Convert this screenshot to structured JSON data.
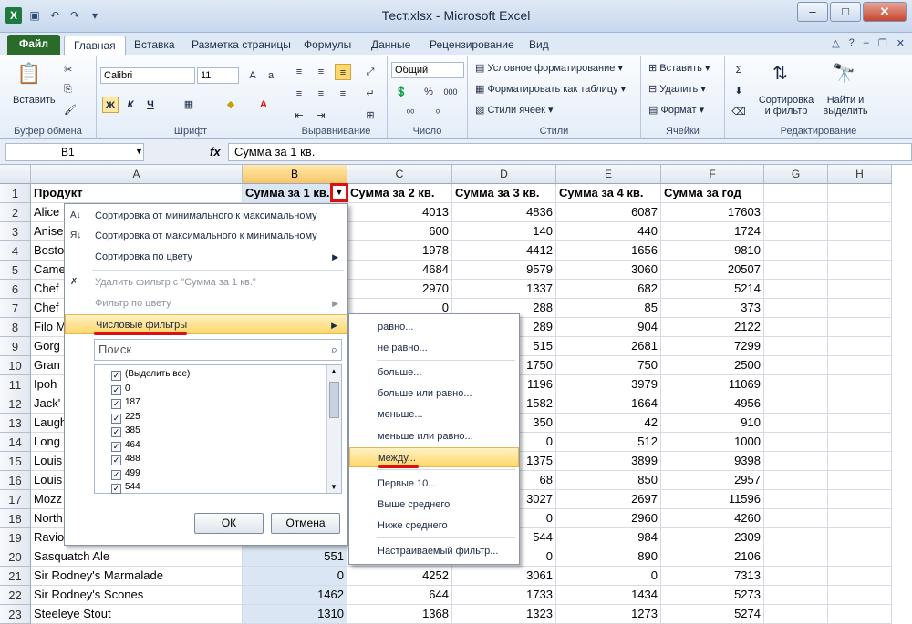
{
  "window": {
    "title": "Тест.xlsx - Microsoft Excel",
    "app_icon": "X"
  },
  "tabs": [
    "Файл",
    "Главная",
    "Вставка",
    "Разметка страницы",
    "Формулы",
    "Данные",
    "Рецензирование",
    "Вид"
  ],
  "ribbon": {
    "clipboard": {
      "label": "Буфер обмена",
      "paste": "Вставить"
    },
    "font": {
      "label": "Шрифт",
      "name": "Calibri",
      "size": "11",
      "bold": "Ж",
      "italic": "К",
      "underline": "Ч"
    },
    "alignment": {
      "label": "Выравнивание"
    },
    "number": {
      "label": "Число",
      "format": "Общий",
      "percent": "%",
      "thousands": "000"
    },
    "styles": {
      "label": "Стили",
      "conditional": "Условное форматирование",
      "as_table": "Форматировать как таблицу",
      "cell_styles": "Стили ячеек"
    },
    "cells": {
      "label": "Ячейки",
      "insert": "Вставить",
      "delete": "Удалить",
      "format": "Формат"
    },
    "editing": {
      "label": "Редактирование",
      "sort": "Сортировка",
      "sort2": "и фильтр",
      "find": "Найти и",
      "find2": "выделить"
    }
  },
  "formula_bar": {
    "name_box": "B1",
    "fx": "fx",
    "content": "Сумма за 1 кв."
  },
  "columns": [
    "A",
    "B",
    "C",
    "D",
    "E",
    "F",
    "G",
    "H"
  ],
  "rows": [
    {
      "n": "1",
      "a": "Продукт",
      "b": "Сумма за 1 кв.",
      "c": "Сумма за 2 кв.",
      "d": "Сумма за 3 кв.",
      "e": "Сумма за 4 кв.",
      "f": "Сумма за год"
    },
    {
      "n": "2",
      "a": "Alice",
      "b": "",
      "c": "4013",
      "d": "4836",
      "e": "6087",
      "f": "17603"
    },
    {
      "n": "3",
      "a": "Anise",
      "b": "",
      "c": "600",
      "d": "140",
      "e": "440",
      "f": "1724"
    },
    {
      "n": "4",
      "a": "Bosto",
      "b": "",
      "c": "1978",
      "d": "4412",
      "e": "1656",
      "f": "9810"
    },
    {
      "n": "5",
      "a": "Came",
      "b": "",
      "c": "4684",
      "d": "9579",
      "e": "3060",
      "f": "20507"
    },
    {
      "n": "6",
      "a": "Chef",
      "b": "",
      "c": "2970",
      "d": "1337",
      "e": "682",
      "f": "5214"
    },
    {
      "n": "7",
      "a": "Chef",
      "b": "",
      "c": "0",
      "d": "288",
      "e": "85",
      "f": "373"
    },
    {
      "n": "8",
      "a": "Filo M",
      "b": "",
      "c": "",
      "d": "289",
      "e": "904",
      "f": "2122"
    },
    {
      "n": "9",
      "a": "Gorg",
      "b": "",
      "c": "",
      "d": "515",
      "e": "2681",
      "f": "7299"
    },
    {
      "n": "10",
      "a": "Gran",
      "b": "",
      "c": "",
      "d": "1750",
      "e": "750",
      "f": "2500"
    },
    {
      "n": "11",
      "a": "Ipoh",
      "b": "",
      "c": "",
      "d": "1196",
      "e": "3979",
      "f": "11069"
    },
    {
      "n": "12",
      "a": "Jack'",
      "b": "",
      "c": "",
      "d": "1582",
      "e": "1664",
      "f": "4956"
    },
    {
      "n": "13",
      "a": "Laugh",
      "b": "",
      "c": "",
      "d": "350",
      "e": "42",
      "f": "910"
    },
    {
      "n": "14",
      "a": "Long",
      "b": "",
      "c": "",
      "d": "0",
      "e": "512",
      "f": "1000"
    },
    {
      "n": "15",
      "a": "Louis",
      "b": "",
      "c": "",
      "d": "1375",
      "e": "3899",
      "f": "9398"
    },
    {
      "n": "16",
      "a": "Louis",
      "b": "",
      "c": "",
      "d": "68",
      "e": "850",
      "f": "2957"
    },
    {
      "n": "17",
      "a": "Mozz",
      "b": "",
      "c": "",
      "d": "3027",
      "e": "2697",
      "f": "11596"
    },
    {
      "n": "18",
      "a": "North",
      "b": "",
      "c": "",
      "d": "0",
      "e": "2960",
      "f": "4260"
    },
    {
      "n": "19",
      "a": "Ravio",
      "b": "",
      "c": "",
      "d": "544",
      "e": "984",
      "f": "2309"
    },
    {
      "n": "20",
      "a": "Sasquatch Ale",
      "b": "551",
      "c": "",
      "d": "0",
      "e": "890",
      "f": "2106"
    },
    {
      "n": "21",
      "a": "Sir Rodney's Marmalade",
      "b": "0",
      "c": "4252",
      "d": "3061",
      "e": "0",
      "f": "7313"
    },
    {
      "n": "22",
      "a": "Sir Rodney's Scones",
      "b": "1462",
      "c": "644",
      "d": "1733",
      "e": "1434",
      "f": "5273"
    },
    {
      "n": "23",
      "a": "Steeleye Stout",
      "b": "1310",
      "c": "1368",
      "d": "1323",
      "e": "1273",
      "f": "5274"
    }
  ],
  "filter_menu": {
    "sort_asc": "Сортировка от минимального к максимальному",
    "sort_desc": "Сортировка от максимального к минимальному",
    "sort_color": "Сортировка по цвету",
    "clear_filter": "Удалить фильтр с \"Сумма за 1 кв.\"",
    "filter_color": "Фильтр по цвету",
    "number_filters": "Числовые фильтры",
    "search_placeholder": "Поиск",
    "values": [
      "(Выделить все)",
      "0",
      "187",
      "225",
      "385",
      "464",
      "488",
      "499",
      "544"
    ],
    "ok": "ОК",
    "cancel": "Отмена"
  },
  "number_filters_submenu": [
    "равно...",
    "не равно...",
    "больше...",
    "больше или равно...",
    "меньше...",
    "меньше или равно...",
    "между...",
    "Первые 10...",
    "Выше среднего",
    "Ниже среднего",
    "Настраиваемый фильтр..."
  ],
  "colors": {
    "accent": "#d11",
    "selected_col": "#dbe6f4",
    "file_tab": "#2a6b2a",
    "highlight": "#ffd76a"
  }
}
